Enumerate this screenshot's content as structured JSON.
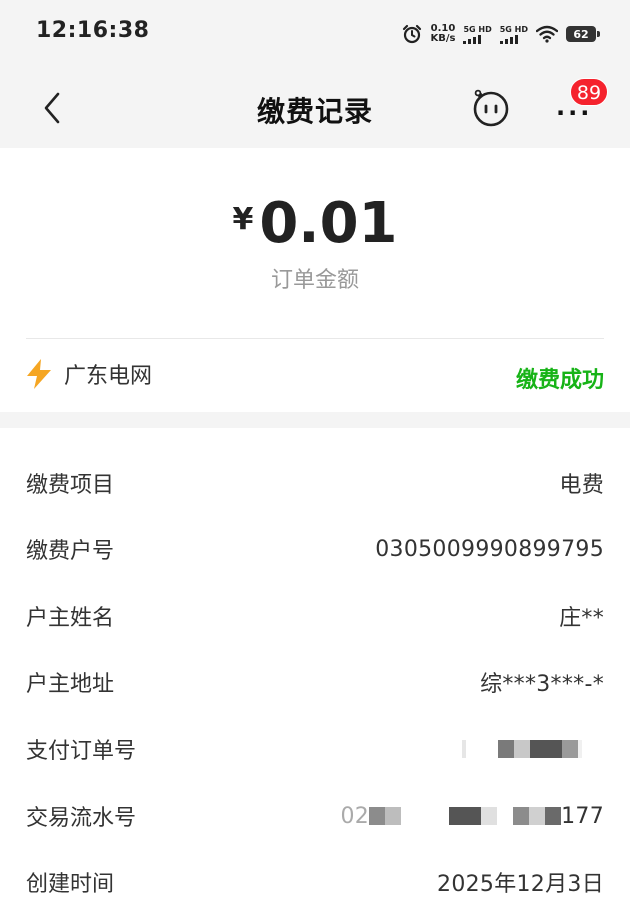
{
  "status_bar": {
    "time": "12:16:38",
    "net_speed_value": "0.10",
    "net_speed_unit": "KB/s",
    "signal1_label": "5G HD",
    "signal2_label": "5G HD",
    "battery": "62",
    "icons": [
      "alarm-icon",
      "signal-icon",
      "wifi-icon",
      "battery-icon"
    ]
  },
  "nav": {
    "title": "缴费记录",
    "back_icon": "chevron-left-icon",
    "robot_icon": "robot-face-icon",
    "more_icon": "more-dots-icon",
    "badge": "89"
  },
  "order": {
    "currency": "¥",
    "amount": "0.01",
    "amount_label": "订单金额",
    "merchant": "广东电网",
    "merchant_icon": "lightning-icon",
    "status": "缴费成功",
    "status_color": "#17b317",
    "accent_color": "#f5a623"
  },
  "details": [
    {
      "label": "缴费项目",
      "value": "电费"
    },
    {
      "label": "缴费户号",
      "value": "0305009990899795"
    },
    {
      "label": "户主姓名",
      "value": "庄**"
    },
    {
      "label": "户主地址",
      "value": "综***3***-*"
    },
    {
      "label": "支付订单号",
      "value": ""
    },
    {
      "label": "交易流水号",
      "value_prefix": "02",
      "value_suffix": "177"
    },
    {
      "label": "创建时间",
      "value": "2025年12月3日"
    }
  ]
}
